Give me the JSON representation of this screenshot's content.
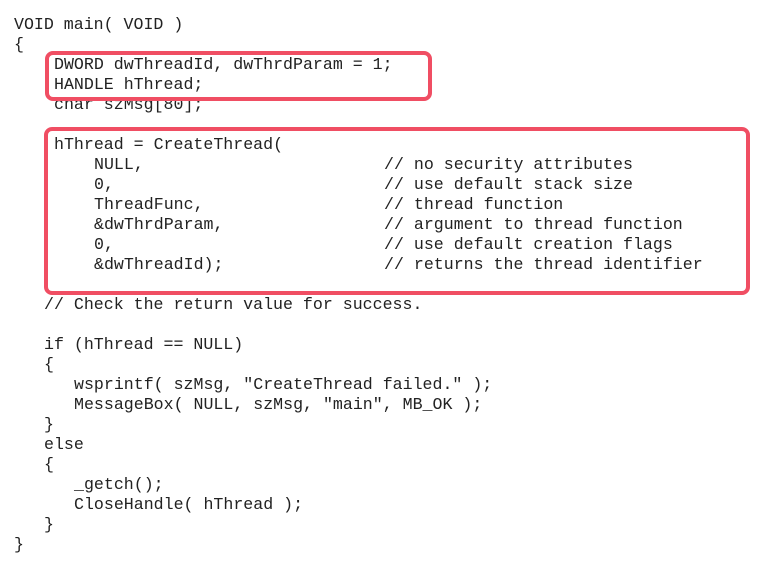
{
  "code": {
    "lines": [
      {
        "indent": 0,
        "text": "VOID main( VOID )",
        "comment": ""
      },
      {
        "indent": 0,
        "text": "{",
        "comment": ""
      },
      {
        "indent": 4,
        "text": "DWORD dwThreadId, dwThrdParam = 1;",
        "comment": ""
      },
      {
        "indent": 4,
        "text": "HANDLE hThread;",
        "comment": ""
      },
      {
        "indent": 4,
        "text": "char szMsg[80];",
        "comment": ""
      },
      {
        "indent": 0,
        "text": "",
        "comment": ""
      },
      {
        "indent": 4,
        "text": "hThread = CreateThread(",
        "comment": ""
      },
      {
        "indent": 8,
        "text": "NULL,",
        "comment": "// no security attributes"
      },
      {
        "indent": 8,
        "text": "0,",
        "comment": "// use default stack size"
      },
      {
        "indent": 8,
        "text": "ThreadFunc,",
        "comment": "// thread function"
      },
      {
        "indent": 8,
        "text": "&dwThrdParam,",
        "comment": "// argument to thread function"
      },
      {
        "indent": 8,
        "text": "0,",
        "comment": "// use default creation flags"
      },
      {
        "indent": 8,
        "text": "&dwThreadId);",
        "comment": "// returns the thread identifier"
      },
      {
        "indent": 0,
        "text": "",
        "comment": ""
      },
      {
        "indent": 3,
        "text": "// Check the return value for success.",
        "comment": ""
      },
      {
        "indent": 0,
        "text": "",
        "comment": ""
      },
      {
        "indent": 3,
        "text": "if (hThread == NULL)",
        "comment": ""
      },
      {
        "indent": 3,
        "text": "{",
        "comment": ""
      },
      {
        "indent": 6,
        "text": "wsprintf( szMsg, \"CreateThread failed.\" );",
        "comment": ""
      },
      {
        "indent": 6,
        "text": "MessageBox( NULL, szMsg, \"main\", MB_OK );",
        "comment": ""
      },
      {
        "indent": 3,
        "text": "}",
        "comment": ""
      },
      {
        "indent": 3,
        "text": "else",
        "comment": ""
      },
      {
        "indent": 3,
        "text": "{",
        "comment": ""
      },
      {
        "indent": 6,
        "text": "_getch();",
        "comment": ""
      },
      {
        "indent": 6,
        "text": "CloseHandle( hThread );",
        "comment": ""
      },
      {
        "indent": 3,
        "text": "}",
        "comment": ""
      },
      {
        "indent": 0,
        "text": "}",
        "comment": ""
      }
    ]
  },
  "highlight_color": "#f04e63"
}
